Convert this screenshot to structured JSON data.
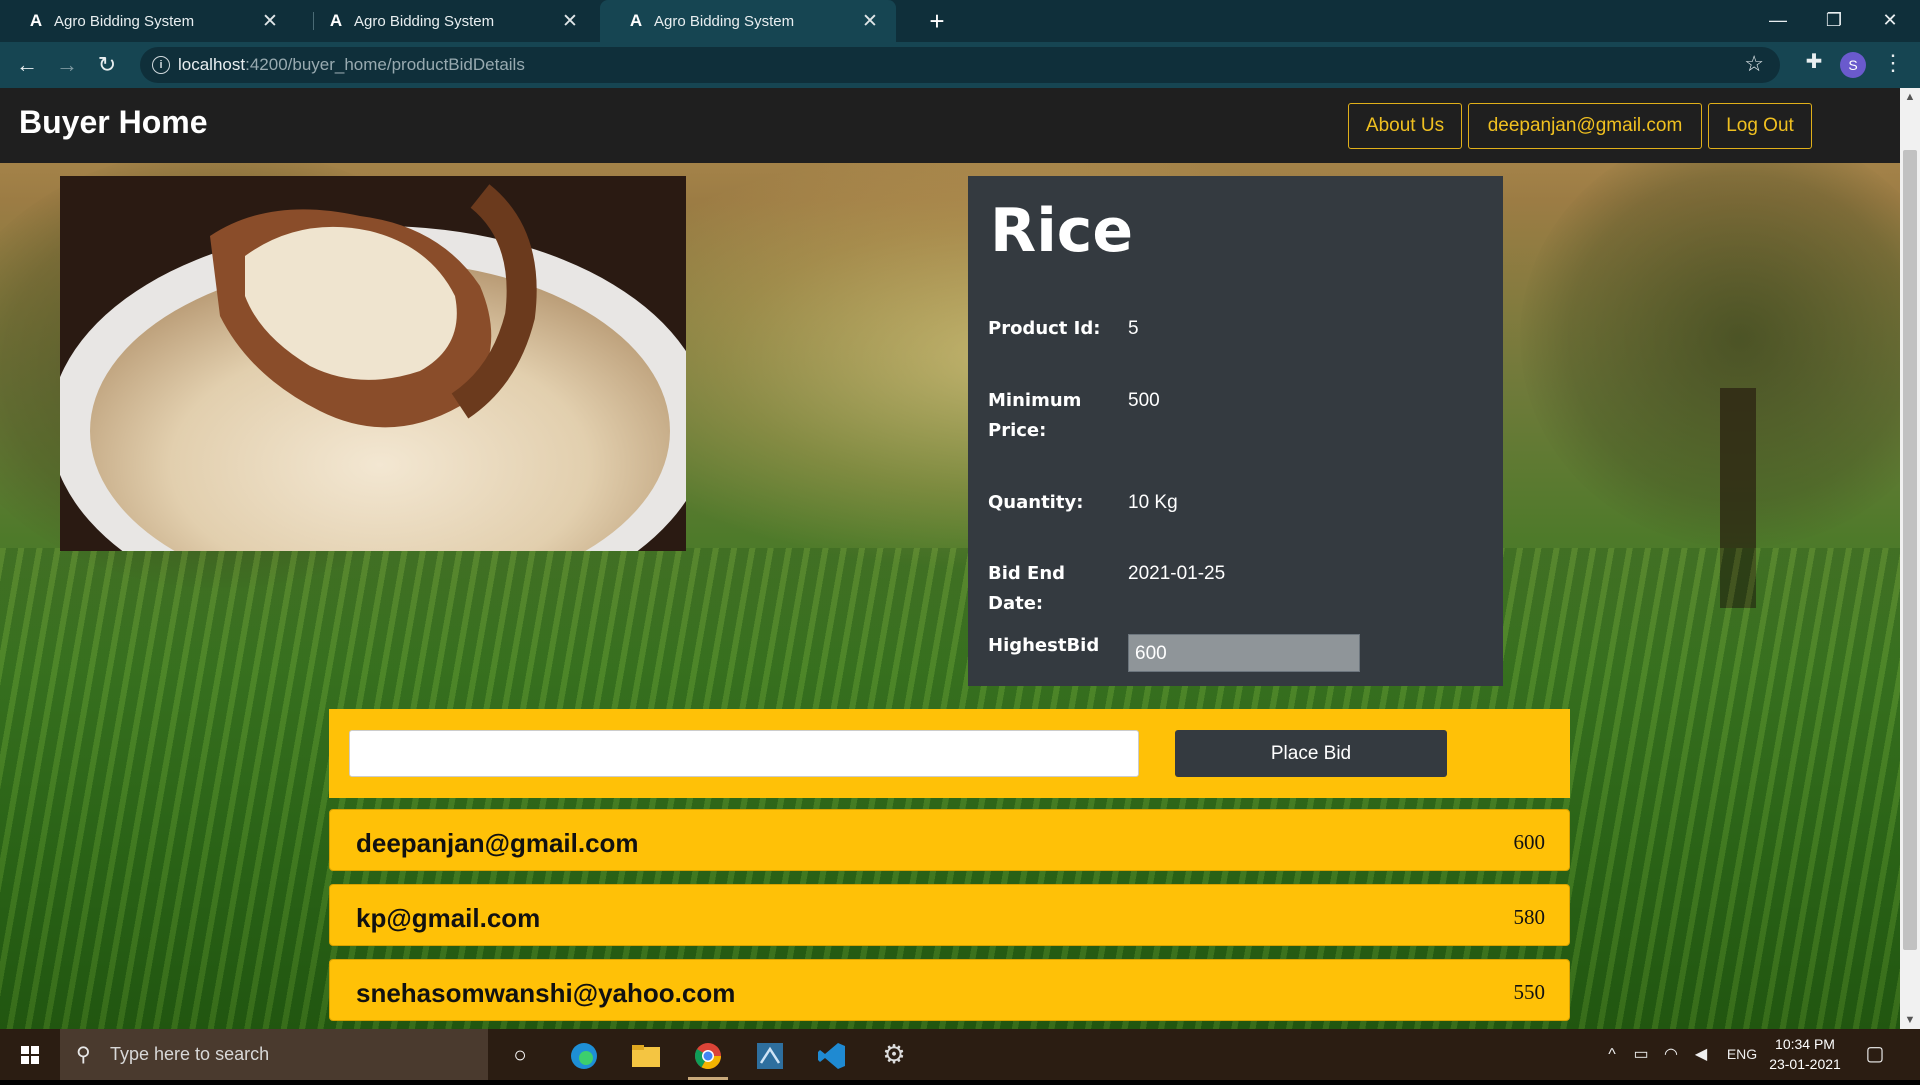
{
  "browser": {
    "tabs": [
      {
        "title": "Agro Bidding System",
        "favicon": "A"
      },
      {
        "title": "Agro Bidding System",
        "favicon": "A"
      },
      {
        "title": "Agro Bidding System",
        "favicon": "A"
      }
    ],
    "active_tab": 2,
    "url_host": "localhost",
    "url_path": ":4200/buyer_home/productBidDetails",
    "profile_initial": "S"
  },
  "app": {
    "brand": "Buyer Home",
    "nav": {
      "about": "About Us",
      "user": "deepanjan@gmail.com",
      "logout": "Log Out"
    }
  },
  "product": {
    "name": "Rice",
    "fields": {
      "id_label": "Product Id:",
      "id_value": "5",
      "min_label": "Minimum Price:",
      "min_value": "500",
      "qty_label": "Quantity:",
      "qty_value": "10 Kg",
      "end_label": "Bid End Date:",
      "end_value": "2021-01-25",
      "highest_label": "HighestBid",
      "highest_value": "600"
    }
  },
  "bid_form": {
    "input_value": "",
    "button": "Place Bid"
  },
  "bids": [
    {
      "email": "deepanjan@gmail.com",
      "amount": "600"
    },
    {
      "email": "kp@gmail.com",
      "amount": "580"
    },
    {
      "email": "snehasomwanshi@yahoo.com",
      "amount": "550"
    }
  ],
  "taskbar": {
    "search_placeholder": "Type here to search",
    "lang": "ENG",
    "time": "10:34 PM",
    "date": "23-01-2021"
  },
  "colors": {
    "accent": "#ffc107",
    "dark_panel": "#343a40",
    "nav_bg": "#1f1f1f",
    "chrome": "#164552"
  }
}
